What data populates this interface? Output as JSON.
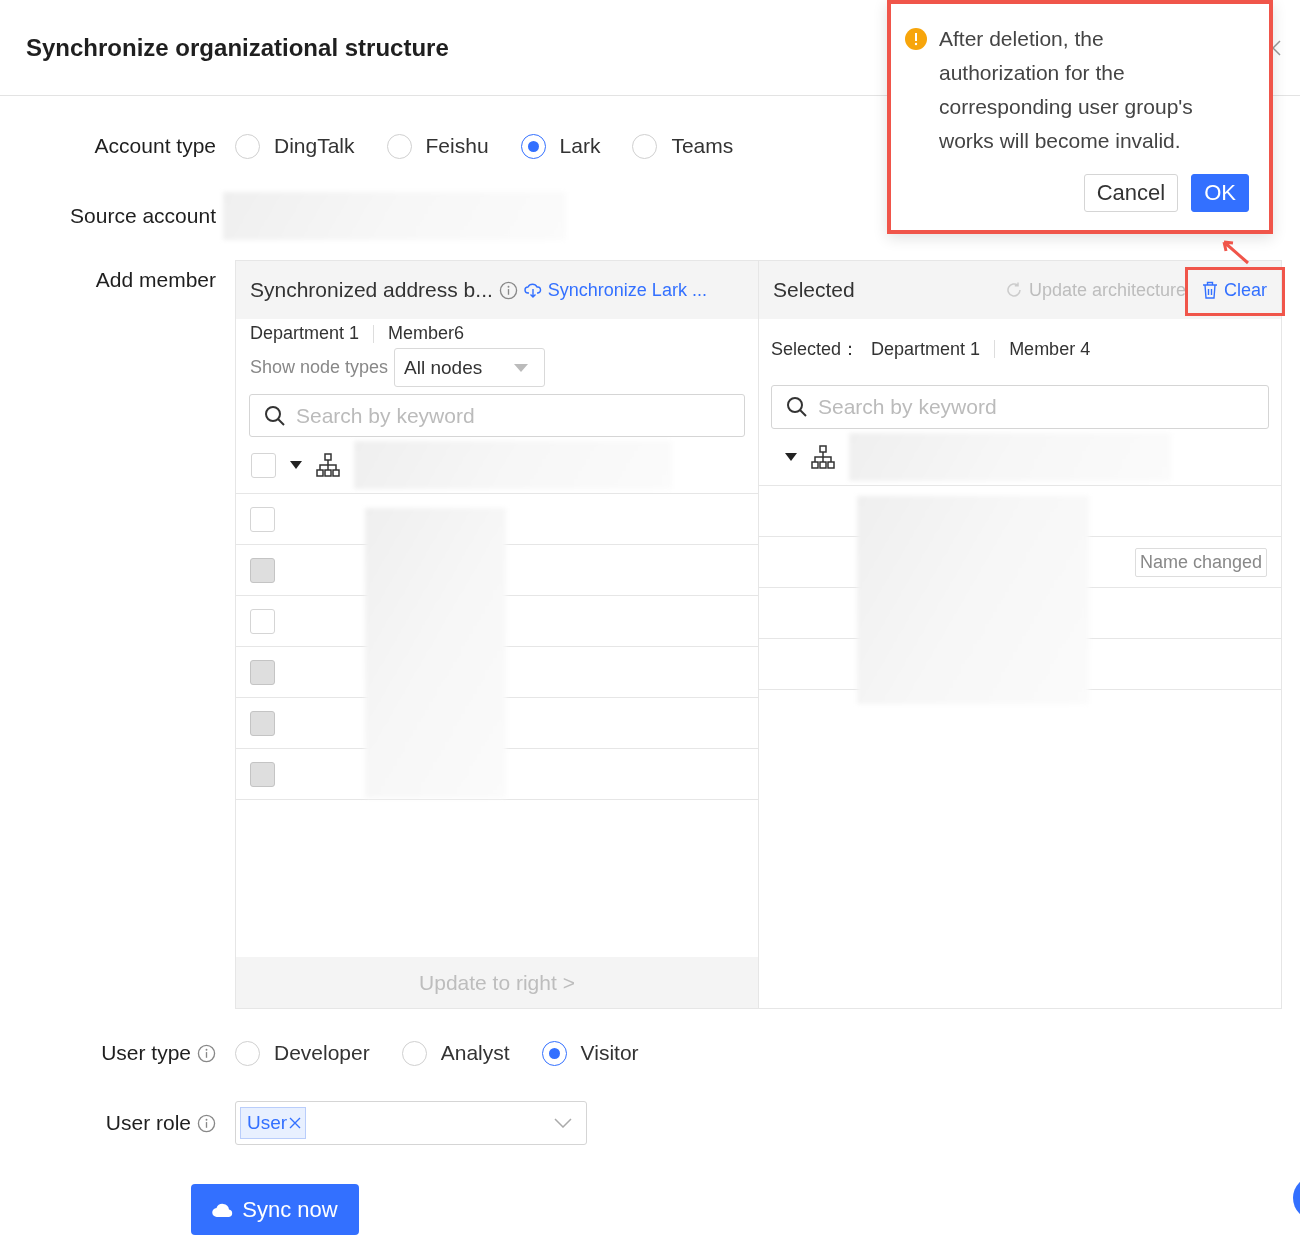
{
  "dialog": {
    "title": "Synchronize organizational structure"
  },
  "account_type": {
    "label": "Account type",
    "options": [
      {
        "label": "DingTalk",
        "selected": false
      },
      {
        "label": "Feishu",
        "selected": false
      },
      {
        "label": "Lark",
        "selected": true
      },
      {
        "label": "Teams",
        "selected": false
      }
    ]
  },
  "source_account": {
    "label": "Source account"
  },
  "add_member": {
    "label": "Add member",
    "source_panel": {
      "title": "Synchronized address b...",
      "action": "Synchronize Lark ...",
      "breadcrumb": [
        "Department 1",
        "Member6"
      ],
      "node_type": {
        "label": "Show node types",
        "value": "All nodes"
      },
      "search": {
        "placeholder": "Search by keyword"
      },
      "select_all": {
        "checked": false
      },
      "rows": [
        {
          "disabled": false
        },
        {
          "disabled": true
        },
        {
          "disabled": false
        },
        {
          "disabled": true
        },
        {
          "disabled": true
        },
        {
          "disabled": true
        }
      ],
      "footer": {
        "label": "Update to right >",
        "disabled": true
      }
    },
    "selected_panel": {
      "title": "Selected",
      "update": {
        "label": "Update architecture",
        "disabled": true
      },
      "clear": "Clear",
      "summary_label": "Selected：",
      "summary": [
        "Department 1",
        "Member 4"
      ],
      "search": {
        "placeholder": "Search by keyword"
      },
      "rows": [
        {},
        {
          "tag": "Name changed"
        },
        {},
        {}
      ]
    }
  },
  "user_type": {
    "label": "User type",
    "options": [
      {
        "label": "Developer",
        "selected": false
      },
      {
        "label": "Analyst",
        "selected": false
      },
      {
        "label": "Visitor",
        "selected": true
      }
    ]
  },
  "user_role": {
    "label": "User role",
    "tags": [
      "User"
    ]
  },
  "sync_button": "Sync now",
  "popconfirm": {
    "message": "After deletion, the authorization for the corresponding user group's works will become invalid.",
    "cancel": "Cancel",
    "ok": "OK"
  }
}
